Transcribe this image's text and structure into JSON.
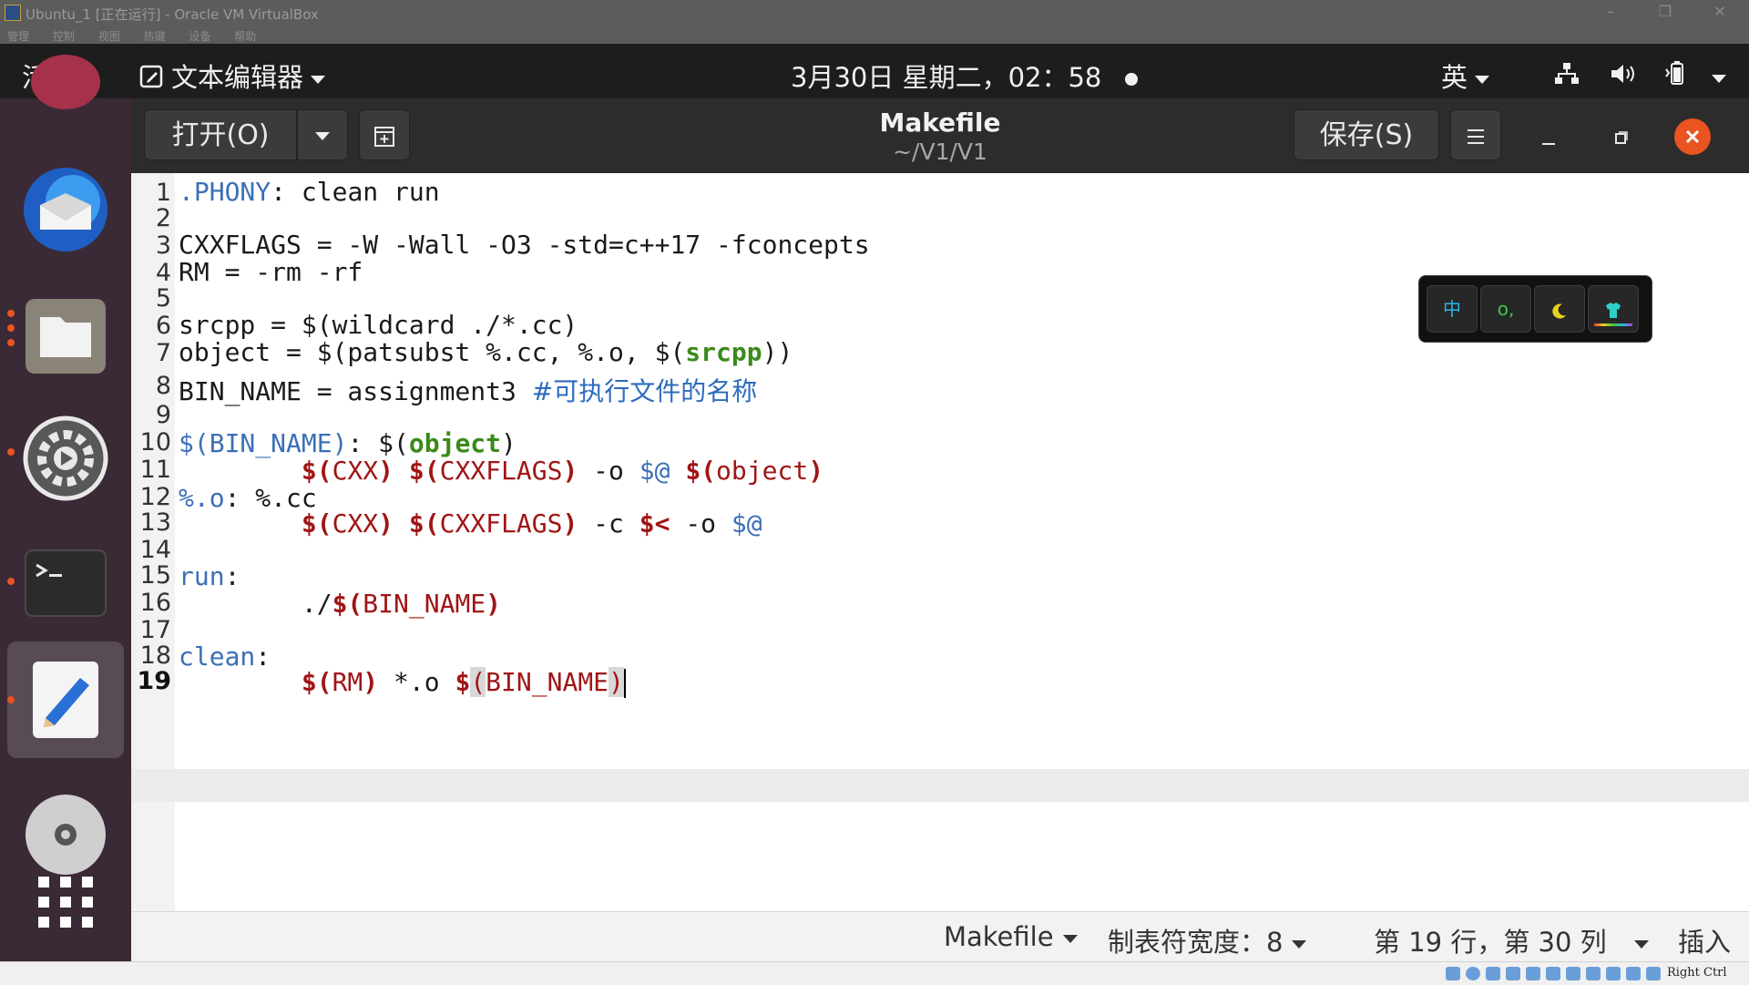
{
  "vbox": {
    "title": "Ubuntu_1 [正在运行] - Oracle VM VirtualBox",
    "menu": [
      "管理",
      "控制",
      "视图",
      "热键",
      "设备",
      "帮助"
    ],
    "host_key": "Right Ctrl"
  },
  "topbar": {
    "activities": "活动",
    "app_menu": "文本编辑器",
    "clock": "3月30日 星期二，02：58",
    "input_method": "英"
  },
  "headerbar": {
    "open_label": "打开(O)",
    "title": "Makefile",
    "subtitle": "~/V1/V1",
    "save_label": "保存(S)"
  },
  "editor": {
    "current_line": 19,
    "lines": [
      ".PHONY: clean run",
      "",
      "CXXFLAGS = -W -Wall -O3 -std=c++17 -fconcepts",
      "RM = -rm -rf",
      "",
      "srcpp = $(wildcard ./*.cc)",
      "object = $(patsubst %.cc, %.o, $(srcpp))",
      "BIN_NAME = assignment3 #可执行文件的名称",
      "",
      "$(BIN_NAME): $(object)",
      "\t$(CXX) $(CXXFLAGS) -o $@ $(object)",
      "%.o: %.cc",
      "\t$(CXX) $(CXXFLAGS) -c $< -o $@",
      "",
      "run:",
      "\t./$(BIN_NAME)",
      "",
      "clean:",
      "\t$(RM) *.o $(BIN_NAME)"
    ]
  },
  "ime": {
    "chinese": "中",
    "punct": "o,"
  },
  "statusbar": {
    "language": "Makefile",
    "tab_width": "制表符宽度：8",
    "position": "第 19 行，第 30 列",
    "mode": "插入"
  }
}
